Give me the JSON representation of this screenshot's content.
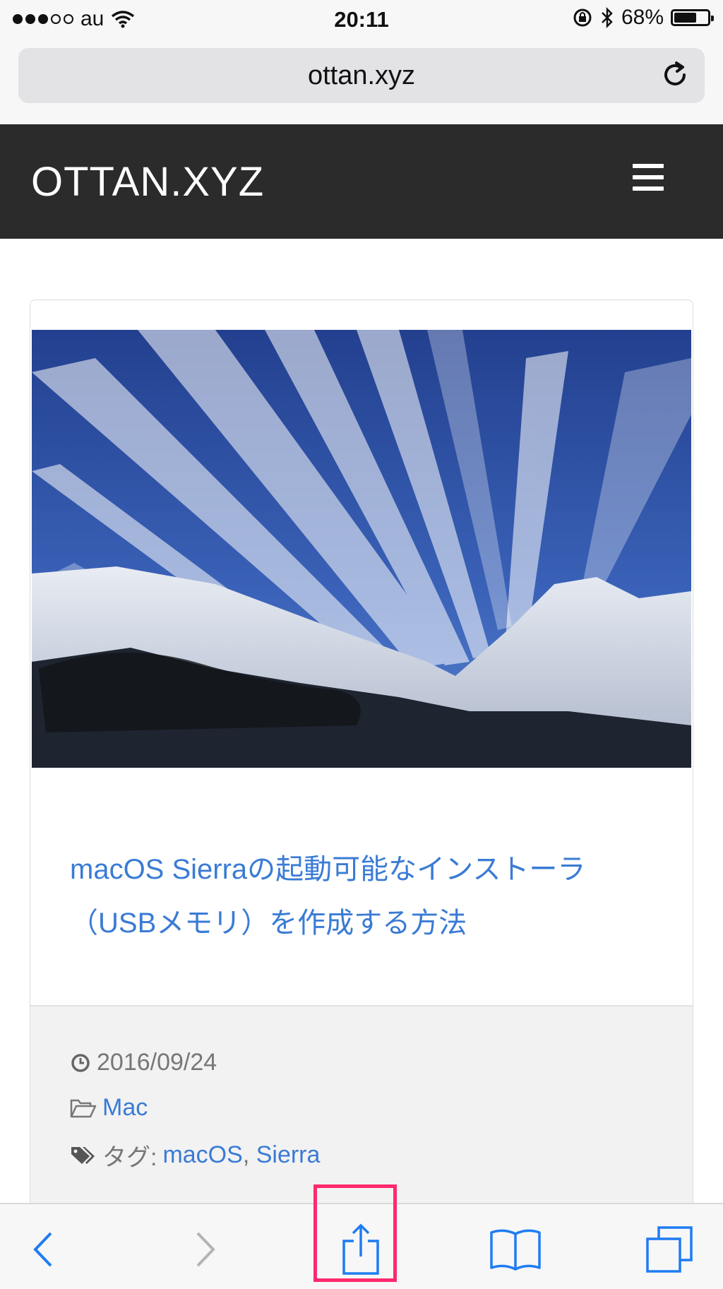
{
  "status_bar": {
    "carrier": "au",
    "time": "20:11",
    "battery_text": "68%",
    "battery_level": 0.68,
    "signal_bars_filled": 3,
    "signal_bars_total": 5
  },
  "browser": {
    "url": "ottan.xyz"
  },
  "site": {
    "logo": "OTTAN.XYZ"
  },
  "post": {
    "title": "macOS Sierraの起動可能なインストーラ（USBメモリ）を作成する方法",
    "date": "2016/09/24",
    "category": "Mac",
    "tags_label": "タグ:",
    "tags": [
      "macOS",
      "Sierra"
    ],
    "tag_separator": ", "
  },
  "toolbar": {
    "items": [
      "back-icon",
      "forward-icon",
      "share-icon",
      "bookmarks-icon",
      "tabs-icon"
    ]
  },
  "colors": {
    "link": "#3a7bd5",
    "header_bg": "#2b2b2b",
    "highlight": "#ff2a6d",
    "ios_blue": "#1e7cf2"
  }
}
